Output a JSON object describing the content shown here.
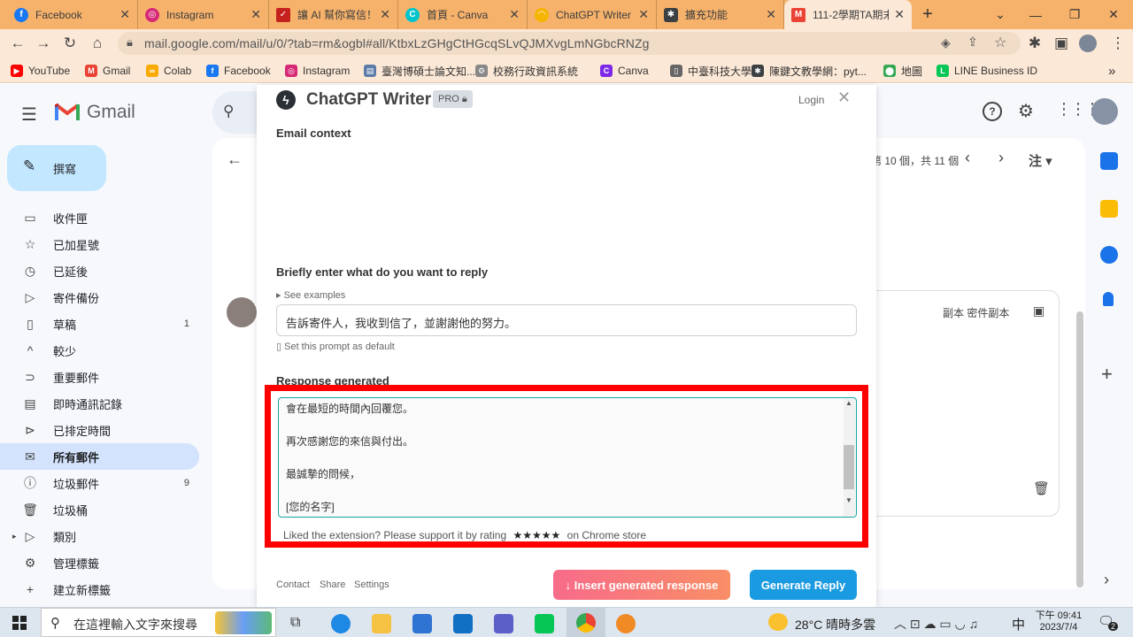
{
  "tabs": [
    {
      "label": "Facebook",
      "icon": "facebook-icon",
      "color": "#1877f2",
      "glyph": "f"
    },
    {
      "label": "Instagram",
      "icon": "instagram-icon",
      "color": "#d62976",
      "glyph": "◎"
    },
    {
      "label": "讓 AI 幫你寫信！",
      "icon": "checkbox-icon",
      "color": "#c5221f",
      "glyph": "✓"
    },
    {
      "label": "首頁 - Canva",
      "icon": "canva-icon",
      "color": "#00c4cc",
      "glyph": "C"
    },
    {
      "label": "ChatGPT Writer",
      "icon": "rainbow-icon",
      "color": "#f4b400",
      "glyph": "◠"
    },
    {
      "label": "擴充功能",
      "icon": "puzzle-icon",
      "color": "#3c4043",
      "glyph": "✱"
    },
    {
      "label": "111-2學期TA期末",
      "icon": "gmail-icon",
      "color": "#ea4335",
      "glyph": "M"
    }
  ],
  "browser": {
    "url": "mail.google.com/mail/u/0/?tab=rm&ogbl#all/KtbxLzGHgCtHGcqSLvQJMXvgLmNGbcRNZg",
    "new_tab": "+",
    "minimize": "—",
    "restore": "❐",
    "close": "✕",
    "dropdown": "⌄"
  },
  "bookmarks": [
    {
      "label": "YouTube",
      "color": "#ff0000",
      "glyph": "▶"
    },
    {
      "label": "Gmail",
      "color": "#ea4335",
      "glyph": "M"
    },
    {
      "label": "Colab",
      "color": "#f9ab00",
      "glyph": "∞"
    },
    {
      "label": "Facebook",
      "color": "#1877f2",
      "glyph": "f"
    },
    {
      "label": "Instagram",
      "color": "#d62976",
      "glyph": "◎"
    },
    {
      "label": "臺灣博碩士論文知...",
      "color": "#5b7ba8",
      "glyph": "▤"
    },
    {
      "label": "校務行政資訊系統",
      "color": "#888888",
      "glyph": "⚙"
    },
    {
      "label": "Canva",
      "color": "#7d2ae8",
      "glyph": "C"
    },
    {
      "label": "中臺科技大學",
      "color": "#666666",
      "glyph": "▯"
    },
    {
      "label": "陳鍵文教學網：pyt...",
      "color": "#3c4043",
      "glyph": "✱"
    },
    {
      "label": "地圖",
      "color": "#34a853",
      "glyph": "⬤"
    },
    {
      "label": "LINE Business ID",
      "color": "#06c755",
      "glyph": "L"
    }
  ],
  "gmail": {
    "brand": "Gmail",
    "compose": "撰寫",
    "nav": [
      {
        "label": "收件匣",
        "icon": "inbox-icon",
        "glyph": "▭",
        "count": ""
      },
      {
        "label": "已加星號",
        "icon": "star-icon",
        "glyph": "☆",
        "count": ""
      },
      {
        "label": "已延後",
        "icon": "clock-icon",
        "glyph": "◷",
        "count": ""
      },
      {
        "label": "寄件備份",
        "icon": "send-icon",
        "glyph": "▷",
        "count": ""
      },
      {
        "label": "草稿",
        "icon": "draft-icon",
        "glyph": "▯",
        "count": "1"
      },
      {
        "label": "較少",
        "icon": "chevron-up-icon",
        "glyph": "^",
        "count": ""
      },
      {
        "label": "重要郵件",
        "icon": "important-icon",
        "glyph": "⊃",
        "count": ""
      },
      {
        "label": "即時通訊記錄",
        "icon": "chat-icon",
        "glyph": "▤",
        "count": ""
      },
      {
        "label": "已排定時間",
        "icon": "scheduled-icon",
        "glyph": "⊳",
        "count": ""
      },
      {
        "label": "所有郵件",
        "icon": "all-mail-icon",
        "glyph": "✉",
        "count": "",
        "selected": true
      },
      {
        "label": "垃圾郵件",
        "icon": "spam-icon",
        "glyph": "ⓘ",
        "count": "9"
      },
      {
        "label": "垃圾桶",
        "icon": "trash-icon",
        "glyph": "🗑",
        "count": ""
      },
      {
        "label": "類別",
        "icon": "label-icon",
        "glyph": "▷",
        "count": ""
      },
      {
        "label": "管理標籤",
        "icon": "gear-icon",
        "glyph": "⚙",
        "count": ""
      },
      {
        "label": "建立新標籤",
        "icon": "plus-icon",
        "glyph": "+",
        "count": ""
      }
    ],
    "pagination": "第 10 個，共 11 個",
    "lang": "注",
    "copy_text": "副本 密件副本"
  },
  "popup": {
    "title": "ChatGPT Writer",
    "pro": "PRO",
    "login": "Login",
    "email_context_label": "Email context",
    "reply_label": "Briefly enter what do you want to reply",
    "see_examples": "▸ See examples",
    "reply_value": "告訴寄件人，我收到信了，並謝謝他的努力。",
    "set_default": "Set this prompt as default",
    "response_label": "Response generated",
    "response_lines": [
      "會在最短的時間內回覆您。",
      "再次感謝您的來信與付出。",
      "最誠摯的問候，",
      "[您的名字]"
    ],
    "rating_text": "Liked the extension? Please support it by rating",
    "stars": "★★★★★",
    "store_text": "on Chrome store",
    "footer_links": [
      "Contact",
      "Share",
      "Settings"
    ],
    "insert_button": "↓ Insert generated response",
    "generate_button": "Generate Reply"
  },
  "taskbar": {
    "search_placeholder": "在這裡輸入文字來搜尋",
    "weather": "28°C  晴時多雲",
    "ime": "中",
    "time": "下午 09:41",
    "date": "2023/7/4",
    "notifications": "2"
  }
}
